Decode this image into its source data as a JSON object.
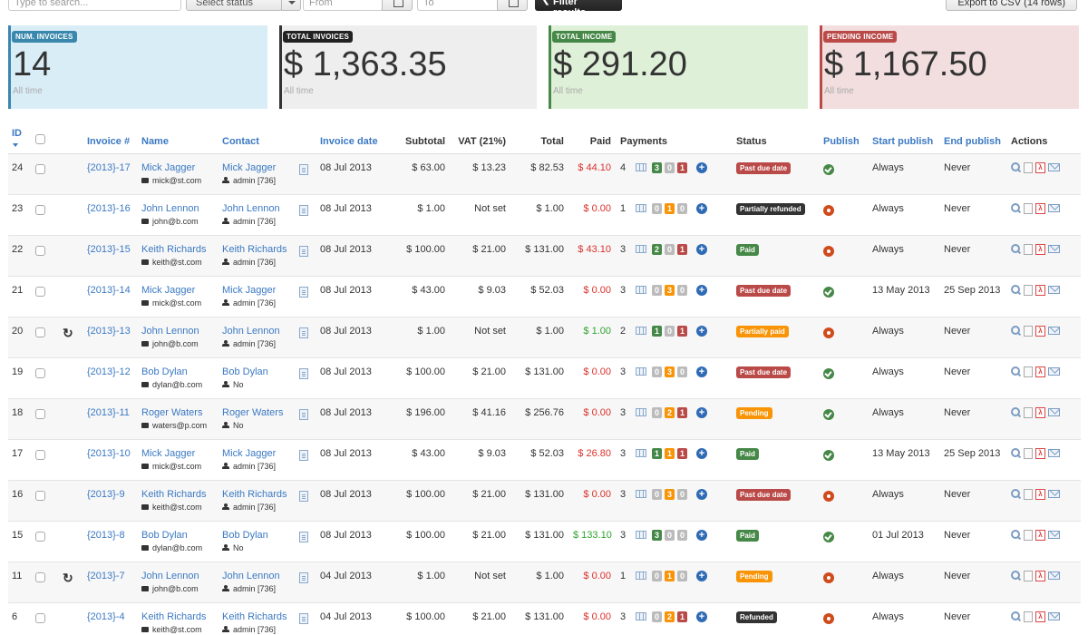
{
  "toolbar": {
    "search_placeholder": "Type to search...",
    "status_select": "Select status",
    "from_placeholder": "From",
    "to_placeholder": "To",
    "filter_label": "Filter results",
    "export_label": "Export to CSV (14 rows)"
  },
  "stats": [
    {
      "label": "NUM. INVOICES",
      "value": "14",
      "sub": "All time",
      "color": "#3a87ad"
    },
    {
      "label": "TOTAL INVOICES",
      "value": "$ 1,363.35",
      "sub": "All time",
      "color": "#222222"
    },
    {
      "label": "TOTAL INCOME",
      "value": "$ 291.20",
      "sub": "All time",
      "color": "#468847"
    },
    {
      "label": "PENDING INCOME",
      "value": "$ 1,167.50",
      "sub": "All time",
      "color": "#b94a48"
    }
  ],
  "columns": {
    "id": "ID",
    "invoice": "Invoice #",
    "name": "Name",
    "contact": "Contact",
    "date": "Invoice date",
    "subtotal": "Subtotal",
    "vat": "VAT (21%)",
    "total": "Total",
    "paid": "Paid",
    "payments": "Payments",
    "status": "Status",
    "publish": "Publish",
    "start": "Start publish",
    "end": "End publish",
    "actions": "Actions"
  },
  "rows": [
    {
      "id": "24",
      "refresh": false,
      "invoice": "{2013}-17",
      "name": "Mick Jagger",
      "email": "mick@st.com",
      "contact": "Mick Jagger",
      "contact_sub": "admin [736]",
      "date": "08 Jul 2013",
      "subtotal": "$ 63.00",
      "vat": "$ 13.23",
      "total": "$ 82.53",
      "paid": "$ 44.10",
      "paid_color": "red",
      "payments": "4",
      "c1": "3",
      "c2": "0",
      "c3": "1",
      "status": "Past due date",
      "status_style": "b-red",
      "publish": true,
      "start": "Always",
      "end": "Never"
    },
    {
      "id": "23",
      "refresh": false,
      "invoice": "{2013}-16",
      "name": "John Lennon",
      "email": "john@b.com",
      "contact": "John Lennon",
      "contact_sub": "admin [736]",
      "date": "08 Jul 2013",
      "subtotal": "$ 1.00",
      "vat": "Not set",
      "total": "$ 1.00",
      "paid": "$ 0.00",
      "paid_color": "red",
      "payments": "1",
      "c1": "0",
      "c2": "1",
      "c3": "0",
      "status": "Partially refunded",
      "status_style": "b-dark",
      "publish": false,
      "start": "Always",
      "end": "Never"
    },
    {
      "id": "22",
      "refresh": false,
      "invoice": "{2013}-15",
      "name": "Keith Richards",
      "email": "keith@st.com",
      "contact": "Keith Richards",
      "contact_sub": "admin [736]",
      "date": "08 Jul 2013",
      "subtotal": "$ 100.00",
      "vat": "$ 21.00",
      "total": "$ 131.00",
      "paid": "$ 43.10",
      "paid_color": "red",
      "payments": "3",
      "c1": "2",
      "c2": "0",
      "c3": "1",
      "status": "Paid",
      "status_style": "b-green",
      "publish": false,
      "start": "Always",
      "end": "Never"
    },
    {
      "id": "21",
      "refresh": false,
      "invoice": "{2013}-14",
      "name": "Mick Jagger",
      "email": "mick@st.com",
      "contact": "Mick Jagger",
      "contact_sub": "admin [736]",
      "date": "08 Jul 2013",
      "subtotal": "$ 43.00",
      "vat": "$ 9.03",
      "total": "$ 52.03",
      "paid": "$ 0.00",
      "paid_color": "red",
      "payments": "3",
      "c1": "0",
      "c2": "3",
      "c3": "0",
      "status": "Past due date",
      "status_style": "b-red",
      "publish": true,
      "start": "13 May 2013",
      "end": "25 Sep 2013"
    },
    {
      "id": "20",
      "refresh": true,
      "invoice": "{2013}-13",
      "name": "John Lennon",
      "email": "john@b.com",
      "contact": "John Lennon",
      "contact_sub": "admin [736]",
      "date": "08 Jul 2013",
      "subtotal": "$ 1.00",
      "vat": "Not set",
      "total": "$ 1.00",
      "paid": "$ 1.00",
      "paid_color": "green",
      "payments": "2",
      "c1": "1",
      "c2": "0",
      "c3": "1",
      "status": "Partially paid",
      "status_style": "b-orange",
      "publish": false,
      "start": "Always",
      "end": "Never"
    },
    {
      "id": "19",
      "refresh": false,
      "invoice": "{2013}-12",
      "name": "Bob Dylan",
      "email": "dylan@b.com",
      "contact": "Bob Dylan",
      "contact_sub": "No",
      "date": "08 Jul 2013",
      "subtotal": "$ 100.00",
      "vat": "$ 21.00",
      "total": "$ 131.00",
      "paid": "$ 0.00",
      "paid_color": "red",
      "payments": "3",
      "c1": "0",
      "c2": "3",
      "c3": "0",
      "status": "Past due date",
      "status_style": "b-red",
      "publish": true,
      "start": "Always",
      "end": "Never"
    },
    {
      "id": "18",
      "refresh": false,
      "invoice": "{2013}-11",
      "name": "Roger Waters",
      "email": "waters@p.com",
      "contact": "Roger Waters",
      "contact_sub": "No",
      "date": "08 Jul 2013",
      "subtotal": "$ 196.00",
      "vat": "$ 41.16",
      "total": "$ 256.76",
      "paid": "$ 0.00",
      "paid_color": "red",
      "payments": "3",
      "c1": "0",
      "c2": "2",
      "c3": "1",
      "status": "Pending",
      "status_style": "b-orange",
      "publish": true,
      "start": "Always",
      "end": "Never"
    },
    {
      "id": "17",
      "refresh": false,
      "invoice": "{2013}-10",
      "name": "Mick Jagger",
      "email": "mick@st.com",
      "contact": "Mick Jagger",
      "contact_sub": "admin [736]",
      "date": "08 Jul 2013",
      "subtotal": "$ 43.00",
      "vat": "$ 9.03",
      "total": "$ 52.03",
      "paid": "$ 26.80",
      "paid_color": "red",
      "payments": "3",
      "c1": "1",
      "c2": "1",
      "c3": "1",
      "status": "Paid",
      "status_style": "b-green",
      "publish": true,
      "start": "13 May 2013",
      "end": "25 Sep 2013"
    },
    {
      "id": "16",
      "refresh": false,
      "invoice": "{2013}-9",
      "name": "Keith Richards",
      "email": "keith@st.com",
      "contact": "Keith Richards",
      "contact_sub": "admin [736]",
      "date": "08 Jul 2013",
      "subtotal": "$ 100.00",
      "vat": "$ 21.00",
      "total": "$ 131.00",
      "paid": "$ 0.00",
      "paid_color": "red",
      "payments": "3",
      "c1": "0",
      "c2": "3",
      "c3": "0",
      "status": "Past due date",
      "status_style": "b-red",
      "publish": false,
      "start": "Always",
      "end": "Never"
    },
    {
      "id": "15",
      "refresh": false,
      "invoice": "{2013}-8",
      "name": "Bob Dylan",
      "email": "dylan@b.com",
      "contact": "Bob Dylan",
      "contact_sub": "No",
      "date": "08 Jul 2013",
      "subtotal": "$ 100.00",
      "vat": "$ 21.00",
      "total": "$ 131.00",
      "paid": "$ 133.10",
      "paid_color": "green",
      "payments": "3",
      "c1": "3",
      "c2": "0",
      "c3": "0",
      "status": "Paid",
      "status_style": "b-green",
      "publish": true,
      "start": "01 Jul 2013",
      "end": "Never"
    },
    {
      "id": "11",
      "refresh": true,
      "invoice": "{2013}-7",
      "name": "John Lennon",
      "email": "john@b.com",
      "contact": "John Lennon",
      "contact_sub": "admin [736]",
      "date": "04 Jul 2013",
      "subtotal": "$ 1.00",
      "vat": "Not set",
      "total": "$ 1.00",
      "paid": "$ 0.00",
      "paid_color": "red",
      "payments": "1",
      "c1": "0",
      "c2": "1",
      "c3": "0",
      "status": "Pending",
      "status_style": "b-orange",
      "publish": false,
      "start": "Always",
      "end": "Never"
    },
    {
      "id": "6",
      "refresh": false,
      "invoice": "{2013}-4",
      "name": "Keith Richards",
      "email": "keith@st.com",
      "contact": "Keith Richards",
      "contact_sub": "admin [736]",
      "date": "04 Jul 2013",
      "subtotal": "$ 100.00",
      "vat": "$ 21.00",
      "total": "$ 131.00",
      "paid": "$ 0.00",
      "paid_color": "red",
      "payments": "3",
      "c1": "0",
      "c2": "2",
      "c3": "1",
      "status": "Refunded",
      "status_style": "b-dark",
      "publish": false,
      "start": "Always",
      "end": "Never"
    }
  ]
}
